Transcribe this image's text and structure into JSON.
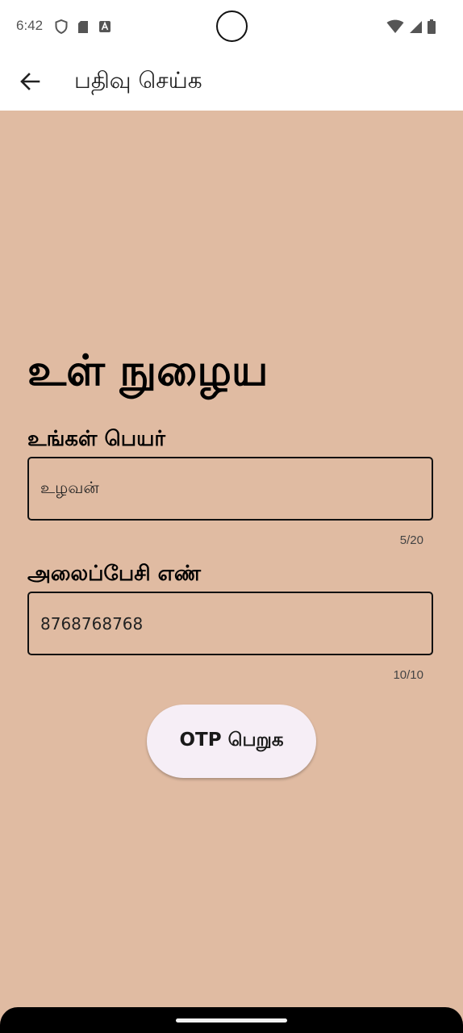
{
  "status_bar": {
    "time": "6:42",
    "left_icons": [
      "shield-icon",
      "sd-card-icon",
      "a-badge-icon"
    ],
    "right_icons": [
      "wifi-icon",
      "signal-icon",
      "battery-icon"
    ]
  },
  "app_bar": {
    "back_icon": "arrow-left-icon",
    "title": "பதிவு செய்க"
  },
  "form": {
    "heading": "உள் நுழைய",
    "name_label": "உங்கள் பெயர்",
    "name_value": "உழவன்",
    "name_counter": "5/20",
    "phone_label": "அலைப்பேசி எண்",
    "phone_value": "8768768768",
    "phone_counter": "10/10",
    "otp_button": "OTP பெறுக"
  },
  "colors": {
    "background": "#e0bba2",
    "bars": "#ffffff",
    "button": "#f6eef6"
  }
}
